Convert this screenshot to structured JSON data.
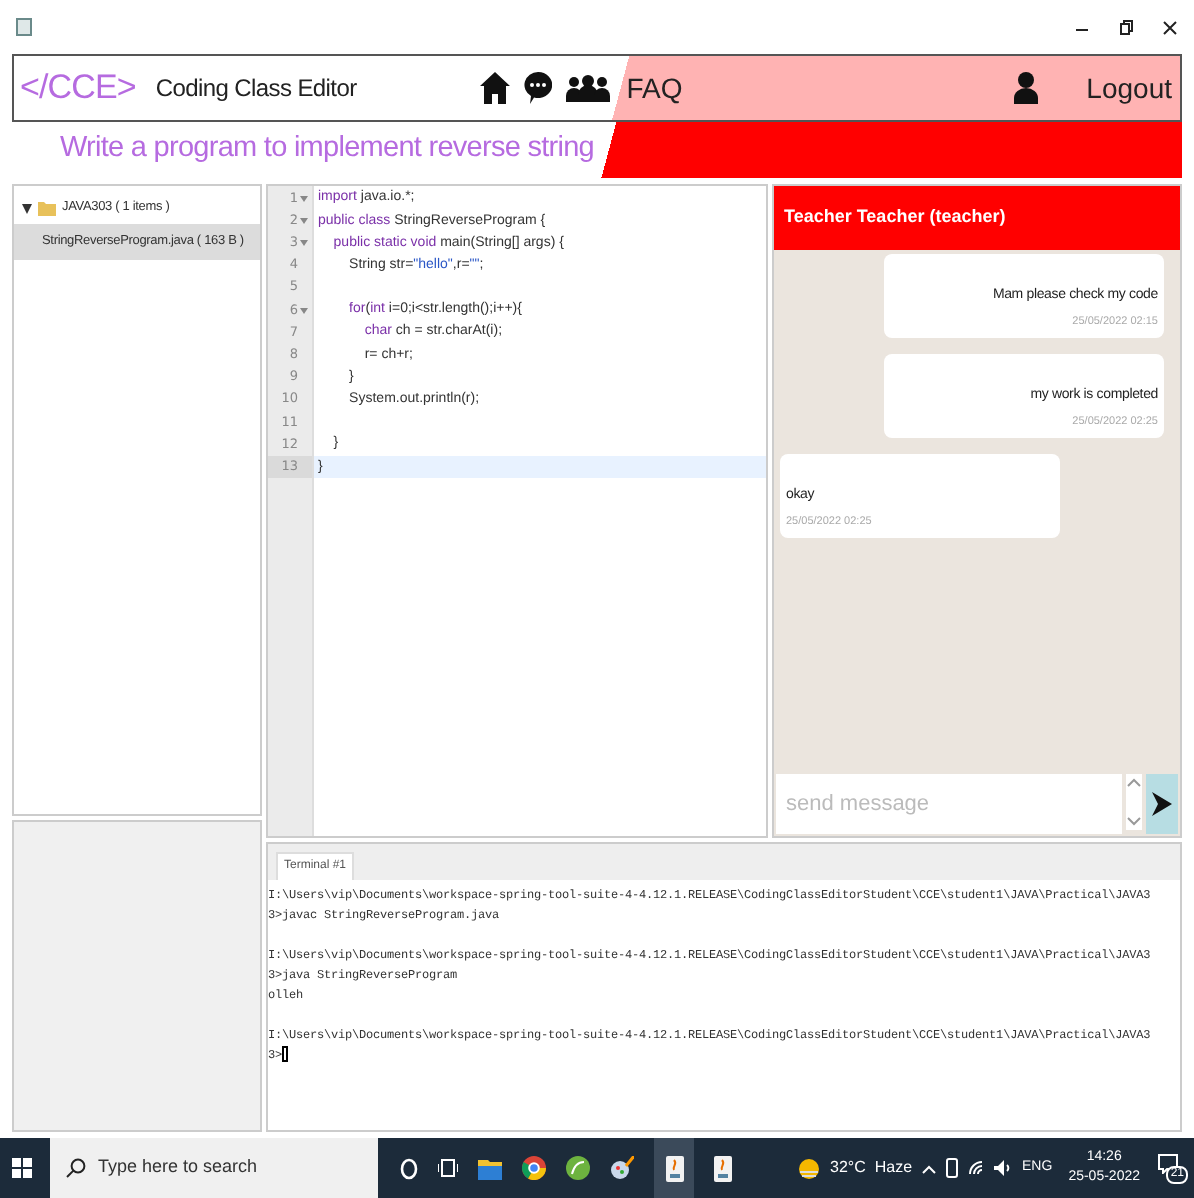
{
  "header": {
    "logo": "</CCE>",
    "app_name": "Coding Class Editor",
    "faq": "FAQ",
    "logout": "Logout"
  },
  "task_title": "Write a program to implement reverse string",
  "tree": {
    "folder": {
      "label": "JAVA303 ( 1 items )",
      "expanded": true,
      "children": [
        {
          "label": "StringReverseProgram.java ( 163 B )",
          "selected": true
        }
      ]
    }
  },
  "editor": {
    "lines": [
      {
        "number": "1",
        "fold": true,
        "selected": false,
        "segments": [
          {
            "kind": "keyword",
            "text": "import"
          },
          {
            "kind": "plain",
            "text": " java.io.*;"
          }
        ]
      },
      {
        "number": "2",
        "fold": true,
        "selected": false,
        "segments": [
          {
            "kind": "keyword",
            "text": "public class"
          },
          {
            "kind": "plain",
            "text": " StringReverseProgram {"
          }
        ]
      },
      {
        "number": "3",
        "fold": true,
        "selected": false,
        "segments": [
          {
            "kind": "keyword",
            "text": "    public static void"
          },
          {
            "kind": "plain",
            "text": " main(String[] args) {"
          }
        ]
      },
      {
        "number": "4",
        "fold": false,
        "selected": false,
        "segments": [
          {
            "kind": "plain",
            "text": "        String str="
          },
          {
            "kind": "string",
            "text": "\"hello\""
          },
          {
            "kind": "plain",
            "text": ",r="
          },
          {
            "kind": "string",
            "text": "\"\""
          },
          {
            "kind": "plain",
            "text": ";"
          }
        ]
      },
      {
        "number": "5",
        "fold": false,
        "selected": false
      },
      {
        "number": "6",
        "fold": true,
        "selected": false,
        "segments": [
          {
            "kind": "keyword",
            "text": "        for"
          },
          {
            "kind": "plain",
            "text": "("
          },
          {
            "kind": "keyword",
            "text": "int"
          },
          {
            "kind": "plain",
            "text": " i=0;i<str.length();i++){"
          }
        ]
      },
      {
        "number": "7",
        "fold": false,
        "selected": false,
        "segments": [
          {
            "kind": "keyword",
            "text": "            char"
          },
          {
            "kind": "plain",
            "text": " ch = str.charAt(i);"
          }
        ]
      },
      {
        "number": "8",
        "fold": false,
        "selected": false,
        "segments": [
          {
            "kind": "plain",
            "text": "            r= ch+r;"
          }
        ]
      },
      {
        "number": "9",
        "fold": false,
        "selected": false,
        "segments": [
          {
            "kind": "plain",
            "text": "        }"
          }
        ]
      },
      {
        "number": "10",
        "fold": false,
        "selected": false,
        "segments": [
          {
            "kind": "plain",
            "text": "        System.out.println(r);"
          }
        ]
      },
      {
        "number": "11",
        "fold": false,
        "selected": false
      },
      {
        "number": "12",
        "fold": false,
        "selected": false,
        "segments": [
          {
            "kind": "plain",
            "text": "    }"
          }
        ]
      },
      {
        "number": "13",
        "fold": false,
        "selected": true,
        "segments": [
          {
            "kind": "plain",
            "text": "}"
          }
        ]
      }
    ]
  },
  "chat": {
    "title": "Teacher Teacher (teacher)",
    "messages": [
      {
        "kind": "outgoing",
        "text": "Mam please check my code",
        "time": "25/05/2022 02:15"
      },
      {
        "kind": "outgoing",
        "text": "my work is completed",
        "time": "25/05/2022 02:25"
      },
      {
        "kind": "incoming",
        "text": "okay",
        "time": "25/05/2022 02:25"
      }
    ],
    "input": {
      "placeholder": "send message"
    }
  },
  "terminal": {
    "tab": "Terminal #1",
    "blocks": [
      [
        "I:\\Users\\vip\\Documents\\workspace-spring-tool-suite-4-4.12.1.RELEASE\\CodingClassEditorStudent\\CCE\\student1\\JAVA\\Practical\\JAVA3",
        "3>javac StringReverseProgram.java"
      ],
      [
        "I:\\Users\\vip\\Documents\\workspace-spring-tool-suite-4-4.12.1.RELEASE\\CodingClassEditorStudent\\CCE\\student1\\JAVA\\Practical\\JAVA3",
        "3>java StringReverseProgram",
        "olleh"
      ],
      [
        "I:\\Users\\vip\\Documents\\workspace-spring-tool-suite-4-4.12.1.RELEASE\\CodingClassEditorStudent\\CCE\\student1\\JAVA\\Practical\\JAVA3",
        "3>"
      ]
    ]
  },
  "taskbar": {
    "search_placeholder": "Type here to search",
    "weather": "32°C  Haze",
    "language": "ENG",
    "time": "14:26",
    "date": "25-05-2022",
    "notifications": "21"
  }
}
